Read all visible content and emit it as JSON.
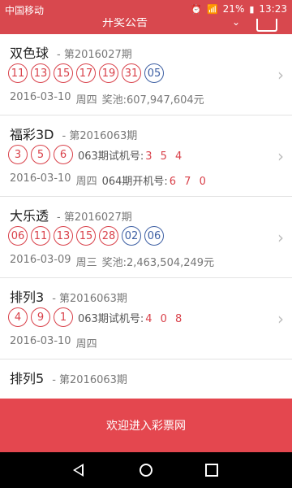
{
  "status_bar": {
    "carrier": "中国移动",
    "battery": "21%",
    "time": "13:23"
  },
  "header": {
    "title": "开奖公告"
  },
  "lotteries": [
    {
      "name": "双色球",
      "issue": "- 第2016027期",
      "red": [
        "11",
        "13",
        "15",
        "17",
        "19",
        "31"
      ],
      "blue": [
        "05"
      ],
      "date": "2016-03-10",
      "weekday": "周四",
      "pool": "奖池:607,947,604元"
    },
    {
      "name": "福彩3D",
      "issue": "- 第2016063期",
      "red": [
        "3",
        "5",
        "6"
      ],
      "trial_label": "063期试机号:",
      "trial_nums": "3 5 4",
      "date": "2016-03-10",
      "weekday": "周四",
      "open_label": "064期开机号:",
      "open_nums": "6 7 0"
    },
    {
      "name": "大乐透",
      "issue": "- 第2016027期",
      "red": [
        "06",
        "11",
        "13",
        "15",
        "28"
      ],
      "blue": [
        "02",
        "06"
      ],
      "date": "2016-03-09",
      "weekday": "周三",
      "pool": "奖池:2,463,504,249元"
    },
    {
      "name": "排列3",
      "issue": "- 第2016063期",
      "red": [
        "4",
        "9",
        "1"
      ],
      "trial_label": "063期试机号:",
      "trial_nums": "4 0 8",
      "date": "2016-03-10",
      "weekday": "周四"
    },
    {
      "name": "排列5",
      "issue": "- 第2016063期"
    }
  ],
  "banner": {
    "text": "欢迎进入彩票网"
  },
  "icons": {
    "chevron": "chevron-right-icon",
    "back": "back-icon",
    "home": "home-icon",
    "recent": "recent-apps-icon"
  },
  "colors": {
    "accent_red": "#d8484e",
    "ball_red": "#d9414a",
    "ball_blue": "#3d5fa3"
  }
}
